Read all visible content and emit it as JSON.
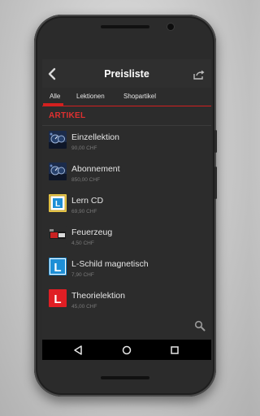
{
  "app": {
    "title": "Preisliste"
  },
  "icons": {
    "back": "back-arrow-icon",
    "share": "share-icon",
    "search": "search-icon"
  },
  "tabs": [
    {
      "label": "Alle",
      "active": true
    },
    {
      "label": "Lektionen",
      "active": false
    },
    {
      "label": "Shopartikel",
      "active": false
    }
  ],
  "section": {
    "title": "ARTIKEL"
  },
  "items": [
    {
      "name": "Einzellektion",
      "price": "90,00 CHF",
      "icon": "car-dashboard-icon"
    },
    {
      "name": "Abonnement",
      "price": "850,00 CHF",
      "icon": "car-dashboard-icon"
    },
    {
      "name": "Lern CD",
      "price": "69,90 CHF",
      "icon": "learner-cd-icon"
    },
    {
      "name": "Feuerzeug",
      "price": "4,50 CHF",
      "icon": "lighter-icon"
    },
    {
      "name": "L-Schild magnetisch",
      "price": "7,90 CHF",
      "icon": "l-sign-blue-icon"
    },
    {
      "name": "Theorielektion",
      "price": "45,00 CHF",
      "icon": "l-sign-red-icon"
    }
  ],
  "colors": {
    "accent": "#d3201f",
    "background": "#2c2c2c",
    "text": "#e6e6e6",
    "muted": "#7a7a7a",
    "l_sign_blue": "#1e8fd6",
    "l_sign_red": "#e01e24"
  },
  "nav": {
    "buttons": [
      "back-triangle-icon",
      "home-circle-icon",
      "recents-square-icon"
    ]
  }
}
